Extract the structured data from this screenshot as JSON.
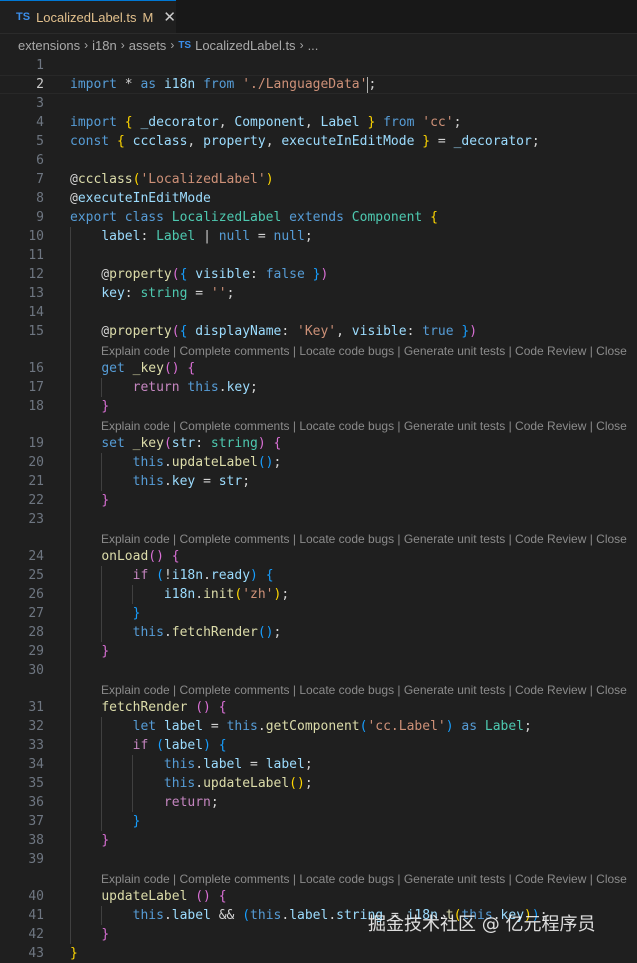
{
  "tab": {
    "badge": "TS",
    "filename": "LocalizedLabel.ts",
    "modified": "M",
    "close": "✕"
  },
  "breadcrumb": [
    "extensions",
    "i18n",
    "assets",
    "LocalizedLabel.ts",
    "..."
  ],
  "breadcrumb_ts_badge": "TS",
  "codelens": "Explain code | Complete comments | Locate code bugs | Generate unit tests | Code Review | Close",
  "active_line": 2,
  "lines": [
    {
      "n": 1,
      "t": []
    },
    {
      "n": 2,
      "t": [
        [
          "k",
          "import"
        ],
        [
          "d",
          " * "
        ],
        [
          "k",
          "as"
        ],
        [
          "d",
          " "
        ],
        [
          "v",
          "i18n"
        ],
        [
          "d",
          " "
        ],
        [
          "k",
          "from"
        ],
        [
          "d",
          " "
        ],
        [
          "s",
          "'./LanguageData'"
        ],
        [
          "cursor",
          ""
        ],
        [
          "d",
          ";"
        ]
      ]
    },
    {
      "n": 3,
      "t": []
    },
    {
      "n": 4,
      "t": [
        [
          "k",
          "import"
        ],
        [
          "d",
          " "
        ],
        [
          "y",
          "{"
        ],
        [
          "d",
          " "
        ],
        [
          "v",
          "_decorator"
        ],
        [
          "d",
          ", "
        ],
        [
          "v",
          "Component"
        ],
        [
          "d",
          ", "
        ],
        [
          "v",
          "Label"
        ],
        [
          "d",
          " "
        ],
        [
          "y",
          "}"
        ],
        [
          "d",
          " "
        ],
        [
          "k",
          "from"
        ],
        [
          "d",
          " "
        ],
        [
          "s",
          "'cc'"
        ],
        [
          "d",
          ";"
        ]
      ]
    },
    {
      "n": 5,
      "t": [
        [
          "k",
          "const"
        ],
        [
          "d",
          " "
        ],
        [
          "y",
          "{"
        ],
        [
          "d",
          " "
        ],
        [
          "v",
          "ccclass"
        ],
        [
          "d",
          ", "
        ],
        [
          "v",
          "property"
        ],
        [
          "d",
          ", "
        ],
        [
          "v",
          "executeInEditMode"
        ],
        [
          "d",
          " "
        ],
        [
          "y",
          "}"
        ],
        [
          "d",
          " = "
        ],
        [
          "v",
          "_decorator"
        ],
        [
          "d",
          ";"
        ]
      ]
    },
    {
      "n": 6,
      "t": []
    },
    {
      "n": 7,
      "t": [
        [
          "d",
          "@"
        ],
        [
          "f",
          "ccclass"
        ],
        [
          "y",
          "("
        ],
        [
          "s",
          "'LocalizedLabel'"
        ],
        [
          "y",
          ")"
        ]
      ]
    },
    {
      "n": 8,
      "t": [
        [
          "d",
          "@"
        ],
        [
          "v",
          "executeInEditMode"
        ]
      ]
    },
    {
      "n": 9,
      "t": [
        [
          "k",
          "export"
        ],
        [
          "d",
          " "
        ],
        [
          "k",
          "class"
        ],
        [
          "d",
          " "
        ],
        [
          "t",
          "LocalizedLabel"
        ],
        [
          "d",
          " "
        ],
        [
          "k",
          "extends"
        ],
        [
          "d",
          " "
        ],
        [
          "t",
          "Component"
        ],
        [
          "d",
          " "
        ],
        [
          "y",
          "{"
        ]
      ]
    },
    {
      "n": 10,
      "t": [
        [
          "d",
          "    "
        ],
        [
          "v",
          "label"
        ],
        [
          "d",
          ": "
        ],
        [
          "t",
          "Label"
        ],
        [
          "d",
          " | "
        ],
        [
          "k",
          "null"
        ],
        [
          "d",
          " = "
        ],
        [
          "k",
          "null"
        ],
        [
          "d",
          ";"
        ]
      ]
    },
    {
      "n": 11,
      "t": []
    },
    {
      "n": 12,
      "t": [
        [
          "d",
          "    @"
        ],
        [
          "f",
          "property"
        ],
        [
          "p",
          "("
        ],
        [
          "b",
          "{"
        ],
        [
          "d",
          " "
        ],
        [
          "v",
          "visible"
        ],
        [
          "d",
          ": "
        ],
        [
          "k",
          "false"
        ],
        [
          "d",
          " "
        ],
        [
          "b",
          "}"
        ],
        [
          "p",
          ")"
        ]
      ]
    },
    {
      "n": 13,
      "t": [
        [
          "d",
          "    "
        ],
        [
          "v",
          "key"
        ],
        [
          "d",
          ": "
        ],
        [
          "t",
          "string"
        ],
        [
          "d",
          " = "
        ],
        [
          "s",
          "''"
        ],
        [
          "d",
          ";"
        ]
      ]
    },
    {
      "n": 14,
      "t": []
    },
    {
      "n": 15,
      "t": [
        [
          "d",
          "    @"
        ],
        [
          "f",
          "property"
        ],
        [
          "p",
          "("
        ],
        [
          "b",
          "{"
        ],
        [
          "d",
          " "
        ],
        [
          "v",
          "displayName"
        ],
        [
          "d",
          ": "
        ],
        [
          "s",
          "'Key'"
        ],
        [
          "d",
          ", "
        ],
        [
          "v",
          "visible"
        ],
        [
          "d",
          ": "
        ],
        [
          "k",
          "true"
        ],
        [
          "d",
          " "
        ],
        [
          "b",
          "}"
        ],
        [
          "p",
          ")"
        ]
      ],
      "lens": true
    },
    {
      "n": 16,
      "t": [
        [
          "d",
          "    "
        ],
        [
          "k",
          "get"
        ],
        [
          "d",
          " "
        ],
        [
          "f",
          "_key"
        ],
        [
          "p",
          "()"
        ],
        [
          "d",
          " "
        ],
        [
          "p",
          "{"
        ]
      ]
    },
    {
      "n": 17,
      "t": [
        [
          "d",
          "        "
        ],
        [
          "c",
          "return"
        ],
        [
          "d",
          " "
        ],
        [
          "k",
          "this"
        ],
        [
          "d",
          "."
        ],
        [
          "v",
          "key"
        ],
        [
          "d",
          ";"
        ]
      ]
    },
    {
      "n": 18,
      "t": [
        [
          "d",
          "    "
        ],
        [
          "p",
          "}"
        ]
      ],
      "lens": true
    },
    {
      "n": 19,
      "t": [
        [
          "d",
          "    "
        ],
        [
          "k",
          "set"
        ],
        [
          "d",
          " "
        ],
        [
          "f",
          "_key"
        ],
        [
          "p",
          "("
        ],
        [
          "v",
          "str"
        ],
        [
          "d",
          ": "
        ],
        [
          "t",
          "string"
        ],
        [
          "p",
          ")"
        ],
        [
          "d",
          " "
        ],
        [
          "p",
          "{"
        ]
      ]
    },
    {
      "n": 20,
      "t": [
        [
          "d",
          "        "
        ],
        [
          "k",
          "this"
        ],
        [
          "d",
          "."
        ],
        [
          "f",
          "updateLabel"
        ],
        [
          "b",
          "()"
        ],
        [
          "d",
          ";"
        ]
      ]
    },
    {
      "n": 21,
      "t": [
        [
          "d",
          "        "
        ],
        [
          "k",
          "this"
        ],
        [
          "d",
          "."
        ],
        [
          "v",
          "key"
        ],
        [
          "d",
          " = "
        ],
        [
          "v",
          "str"
        ],
        [
          "d",
          ";"
        ]
      ]
    },
    {
      "n": 22,
      "t": [
        [
          "d",
          "    "
        ],
        [
          "p",
          "}"
        ]
      ]
    },
    {
      "n": 23,
      "t": [],
      "lens": true
    },
    {
      "n": 24,
      "t": [
        [
          "d",
          "    "
        ],
        [
          "f",
          "onLoad"
        ],
        [
          "p",
          "()"
        ],
        [
          "d",
          " "
        ],
        [
          "p",
          "{"
        ]
      ]
    },
    {
      "n": 25,
      "t": [
        [
          "d",
          "        "
        ],
        [
          "c",
          "if"
        ],
        [
          "d",
          " "
        ],
        [
          "b",
          "("
        ],
        [
          "d",
          "!"
        ],
        [
          "v",
          "i18n"
        ],
        [
          "d",
          "."
        ],
        [
          "v",
          "ready"
        ],
        [
          "b",
          ")"
        ],
        [
          "d",
          " "
        ],
        [
          "b",
          "{"
        ]
      ]
    },
    {
      "n": 26,
      "t": [
        [
          "d",
          "            "
        ],
        [
          "v",
          "i18n"
        ],
        [
          "d",
          "."
        ],
        [
          "f",
          "init"
        ],
        [
          "y",
          "("
        ],
        [
          "s",
          "'zh'"
        ],
        [
          "y",
          ")"
        ],
        [
          "d",
          ";"
        ]
      ]
    },
    {
      "n": 27,
      "t": [
        [
          "d",
          "        "
        ],
        [
          "b",
          "}"
        ]
      ]
    },
    {
      "n": 28,
      "t": [
        [
          "d",
          "        "
        ],
        [
          "k",
          "this"
        ],
        [
          "d",
          "."
        ],
        [
          "f",
          "fetchRender"
        ],
        [
          "b",
          "()"
        ],
        [
          "d",
          ";"
        ]
      ]
    },
    {
      "n": 29,
      "t": [
        [
          "d",
          "    "
        ],
        [
          "p",
          "}"
        ]
      ]
    },
    {
      "n": 30,
      "t": [],
      "lens": true
    },
    {
      "n": 31,
      "t": [
        [
          "d",
          "    "
        ],
        [
          "f",
          "fetchRender"
        ],
        [
          "d",
          " "
        ],
        [
          "p",
          "()"
        ],
        [
          "d",
          " "
        ],
        [
          "p",
          "{"
        ]
      ]
    },
    {
      "n": 32,
      "t": [
        [
          "d",
          "        "
        ],
        [
          "k",
          "let"
        ],
        [
          "d",
          " "
        ],
        [
          "v",
          "label"
        ],
        [
          "d",
          " = "
        ],
        [
          "k",
          "this"
        ],
        [
          "d",
          "."
        ],
        [
          "f",
          "getComponent"
        ],
        [
          "b",
          "("
        ],
        [
          "s",
          "'cc.Label'"
        ],
        [
          "b",
          ")"
        ],
        [
          "d",
          " "
        ],
        [
          "k",
          "as"
        ],
        [
          "d",
          " "
        ],
        [
          "t",
          "Label"
        ],
        [
          "d",
          ";"
        ]
      ]
    },
    {
      "n": 33,
      "t": [
        [
          "d",
          "        "
        ],
        [
          "c",
          "if"
        ],
        [
          "d",
          " "
        ],
        [
          "b",
          "("
        ],
        [
          "v",
          "label"
        ],
        [
          "b",
          ")"
        ],
        [
          "d",
          " "
        ],
        [
          "b",
          "{"
        ]
      ]
    },
    {
      "n": 34,
      "t": [
        [
          "d",
          "            "
        ],
        [
          "k",
          "this"
        ],
        [
          "d",
          "."
        ],
        [
          "v",
          "label"
        ],
        [
          "d",
          " = "
        ],
        [
          "v",
          "label"
        ],
        [
          "d",
          ";"
        ]
      ]
    },
    {
      "n": 35,
      "t": [
        [
          "d",
          "            "
        ],
        [
          "k",
          "this"
        ],
        [
          "d",
          "."
        ],
        [
          "f",
          "updateLabel"
        ],
        [
          "y",
          "()"
        ],
        [
          "d",
          ";"
        ]
      ]
    },
    {
      "n": 36,
      "t": [
        [
          "d",
          "            "
        ],
        [
          "c",
          "return"
        ],
        [
          "d",
          ";"
        ]
      ]
    },
    {
      "n": 37,
      "t": [
        [
          "d",
          "        "
        ],
        [
          "b",
          "}"
        ]
      ]
    },
    {
      "n": 38,
      "t": [
        [
          "d",
          "    "
        ],
        [
          "p",
          "}"
        ]
      ]
    },
    {
      "n": 39,
      "t": [],
      "lens": true
    },
    {
      "n": 40,
      "t": [
        [
          "d",
          "    "
        ],
        [
          "f",
          "updateLabel"
        ],
        [
          "d",
          " "
        ],
        [
          "p",
          "()"
        ],
        [
          "d",
          " "
        ],
        [
          "p",
          "{"
        ]
      ]
    },
    {
      "n": 41,
      "t": [
        [
          "d",
          "        "
        ],
        [
          "k",
          "this"
        ],
        [
          "d",
          "."
        ],
        [
          "v",
          "label"
        ],
        [
          "d",
          " && "
        ],
        [
          "b",
          "("
        ],
        [
          "k",
          "this"
        ],
        [
          "d",
          "."
        ],
        [
          "v",
          "label"
        ],
        [
          "d",
          "."
        ],
        [
          "v",
          "string"
        ],
        [
          "d",
          " = "
        ],
        [
          "v",
          "i18n"
        ],
        [
          "d",
          "."
        ],
        [
          "f",
          "t"
        ],
        [
          "y",
          "("
        ],
        [
          "k",
          "this"
        ],
        [
          "d",
          "."
        ],
        [
          "v",
          "key"
        ],
        [
          "y",
          ")"
        ],
        [
          "b",
          ")"
        ],
        [
          "d",
          ";"
        ]
      ]
    },
    {
      "n": 42,
      "t": [
        [
          "d",
          "    "
        ],
        [
          "p",
          "}"
        ]
      ]
    },
    {
      "n": 43,
      "t": [
        [
          "y",
          "}"
        ]
      ]
    }
  ],
  "watermark": "掘金技术社区 @ 亿元程序员"
}
